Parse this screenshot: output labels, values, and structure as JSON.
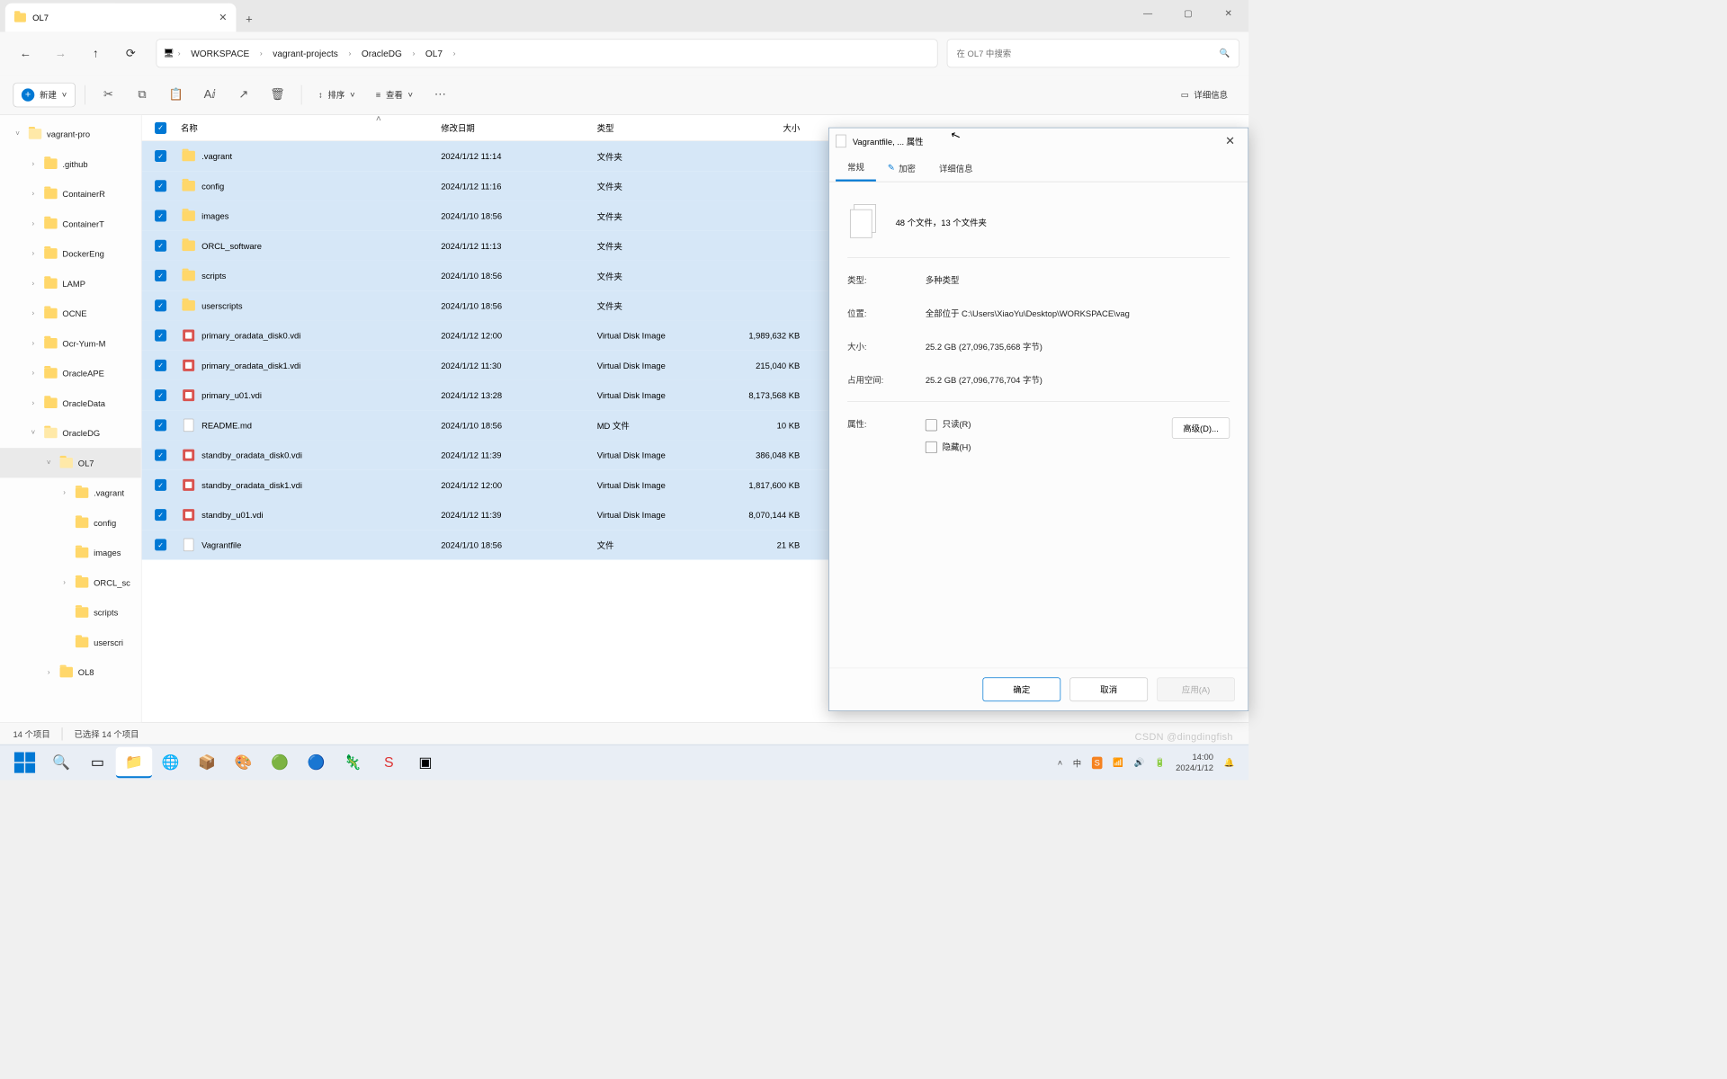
{
  "window": {
    "tab_title": "OL7",
    "new_tab_tooltip": "+",
    "min": "—",
    "max": "▢",
    "close": "✕"
  },
  "nav": {
    "back": "←",
    "fwd": "→",
    "up": "↑",
    "refresh": "⟳"
  },
  "breadcrumb": {
    "pc_icon": "🖥",
    "items": [
      "WORKSPACE",
      "vagrant-projects",
      "OracleDG",
      "OL7"
    ],
    "sep": "›"
  },
  "search": {
    "placeholder": "在 OL7 中搜索",
    "icon": "🔍"
  },
  "toolbar": {
    "new_label": "新建",
    "sort_label": "排序",
    "view_label": "查看",
    "details_label": "详细信息",
    "icons": {
      "cut": "✂",
      "copy": "⧉",
      "paste": "📋",
      "rename": "Aⅈ",
      "share": "↗",
      "delete": "🗑",
      "more": "⋯",
      "sort": "↕",
      "view": "≡",
      "details": "▭"
    },
    "chev": "˅"
  },
  "tree": [
    {
      "indent": 0,
      "chev": "˅",
      "name": "vagrant-pro",
      "open": true
    },
    {
      "indent": 1,
      "chev": "›",
      "name": ".github"
    },
    {
      "indent": 1,
      "chev": "›",
      "name": "ContainerR"
    },
    {
      "indent": 1,
      "chev": "›",
      "name": "ContainerT"
    },
    {
      "indent": 1,
      "chev": "›",
      "name": "DockerEng"
    },
    {
      "indent": 1,
      "chev": "›",
      "name": "LAMP"
    },
    {
      "indent": 1,
      "chev": "›",
      "name": "OCNE"
    },
    {
      "indent": 1,
      "chev": "›",
      "name": "Ocr-Yum-M"
    },
    {
      "indent": 1,
      "chev": "›",
      "name": "OracleAPE"
    },
    {
      "indent": 1,
      "chev": "›",
      "name": "OracleData"
    },
    {
      "indent": 1,
      "chev": "˅",
      "name": "OracleDG",
      "open": true
    },
    {
      "indent": 2,
      "chev": "˅",
      "name": "OL7",
      "open": true,
      "sel": true
    },
    {
      "indent": 3,
      "chev": "›",
      "name": ".vagrant"
    },
    {
      "indent": 3,
      "chev": "",
      "name": "config"
    },
    {
      "indent": 3,
      "chev": "",
      "name": "images"
    },
    {
      "indent": 3,
      "chev": "›",
      "name": "ORCL_sc"
    },
    {
      "indent": 3,
      "chev": "",
      "name": "scripts"
    },
    {
      "indent": 3,
      "chev": "",
      "name": "userscri"
    },
    {
      "indent": 2,
      "chev": "›",
      "name": "OL8"
    }
  ],
  "columns": {
    "name": "名称",
    "date": "修改日期",
    "type": "类型",
    "size": "大小"
  },
  "files": [
    {
      "icon": "folder",
      "name": ".vagrant",
      "date": "2024/1/12 11:14",
      "type": "文件夹",
      "size": ""
    },
    {
      "icon": "folder",
      "name": "config",
      "date": "2024/1/12 11:16",
      "type": "文件夹",
      "size": ""
    },
    {
      "icon": "folder",
      "name": "images",
      "date": "2024/1/10 18:56",
      "type": "文件夹",
      "size": ""
    },
    {
      "icon": "folder",
      "name": "ORCL_software",
      "date": "2024/1/12 11:13",
      "type": "文件夹",
      "size": ""
    },
    {
      "icon": "folder",
      "name": "scripts",
      "date": "2024/1/10 18:56",
      "type": "文件夹",
      "size": ""
    },
    {
      "icon": "folder",
      "name": "userscripts",
      "date": "2024/1/10 18:56",
      "type": "文件夹",
      "size": ""
    },
    {
      "icon": "vdi",
      "name": "primary_oradata_disk0.vdi",
      "date": "2024/1/12 12:00",
      "type": "Virtual Disk Image",
      "size": "1,989,632 KB"
    },
    {
      "icon": "vdi",
      "name": "primary_oradata_disk1.vdi",
      "date": "2024/1/12 11:30",
      "type": "Virtual Disk Image",
      "size": "215,040 KB"
    },
    {
      "icon": "vdi",
      "name": "primary_u01.vdi",
      "date": "2024/1/12 13:28",
      "type": "Virtual Disk Image",
      "size": "8,173,568 KB"
    },
    {
      "icon": "file",
      "name": "README.md",
      "date": "2024/1/10 18:56",
      "type": "MD 文件",
      "size": "10 KB"
    },
    {
      "icon": "vdi",
      "name": "standby_oradata_disk0.vdi",
      "date": "2024/1/12 11:39",
      "type": "Virtual Disk Image",
      "size": "386,048 KB"
    },
    {
      "icon": "vdi",
      "name": "standby_oradata_disk1.vdi",
      "date": "2024/1/12 12:00",
      "type": "Virtual Disk Image",
      "size": "1,817,600 KB"
    },
    {
      "icon": "vdi",
      "name": "standby_u01.vdi",
      "date": "2024/1/12 11:39",
      "type": "Virtual Disk Image",
      "size": "8,070,144 KB"
    },
    {
      "icon": "file",
      "name": "Vagrantfile",
      "date": "2024/1/10 18:56",
      "type": "文件",
      "size": "21 KB"
    }
  ],
  "status": {
    "count": "14 个项目",
    "selected": "已选择 14 个项目"
  },
  "props": {
    "title": "Vagrantfile, ... 属性",
    "tabs": {
      "general": "常规",
      "encrypt": "加密",
      "details": "详细信息"
    },
    "summary": "48 个文件，13 个文件夹",
    "type_label": "类型:",
    "type_value": "多种类型",
    "loc_label": "位置:",
    "loc_value": "全部位于 C:\\Users\\XiaoYu\\Desktop\\WORKSPACE\\vag",
    "size_label": "大小:",
    "size_value": "25.2 GB (27,096,735,668 字节)",
    "ondisk_label": "占用空间:",
    "ondisk_value": "25.2 GB (27,096,776,704 字节)",
    "attr_label": "属性:",
    "readonly": "只读(R)",
    "hidden": "隐藏(H)",
    "advanced": "高级(D)...",
    "ok": "确定",
    "cancel": "取消",
    "apply": "应用(A)"
  },
  "taskbar": {
    "time": "14:00",
    "date": "2024/1/12",
    "tray_chev": "˄"
  },
  "watermark": "CSDN @dingdingfish"
}
